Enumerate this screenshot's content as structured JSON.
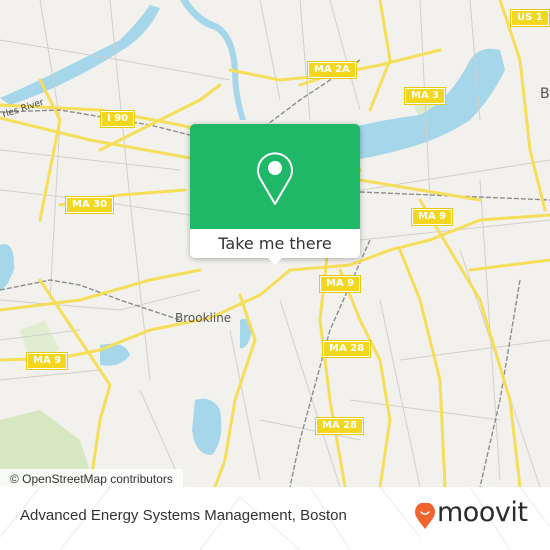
{
  "map": {
    "attribution": "© OpenStreetMap contributors",
    "place_labels": {
      "brookline": "Brookline",
      "boston_partial": "B",
      "charles_river": "rles River"
    },
    "route_shields": {
      "us1": "US 1",
      "ma2a": "MA 2A",
      "ma3": "MA 3",
      "i90": "I 90",
      "ma30": "MA 30",
      "ma9_east": "MA 9",
      "ma9_center": "MA 9",
      "ma9_west": "MA 9",
      "ma28_north": "MA 28",
      "ma28_south": "MA 28"
    },
    "colors": {
      "land": "#f2f1ed",
      "water": "#a5d6ea",
      "road_major": "#f5de59",
      "road_minor": "#cfcdc7",
      "park": "#d6e8c2",
      "rail": "#8d8d8d"
    }
  },
  "popup": {
    "icon": "map-pin-icon",
    "button_label": "Take me there",
    "color": "#1eb866"
  },
  "footer": {
    "location_title": "Advanced Energy Systems Management, Boston",
    "brand": "moovit",
    "brand_color": "#f0652f"
  }
}
